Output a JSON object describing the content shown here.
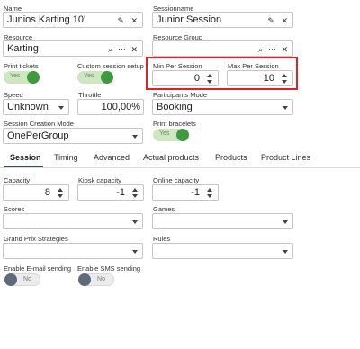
{
  "name": {
    "label": "Name",
    "value": "Junios Karting 10'"
  },
  "sessionname": {
    "label": "Sessionname",
    "value": "Junior Session"
  },
  "resource": {
    "label": "Resource",
    "value": "Karting"
  },
  "resource_group": {
    "label": "Resource Group",
    "value": ""
  },
  "print_tickets": {
    "label": "Print tickets",
    "state": "Yes"
  },
  "custom_session_setup": {
    "label": "Custom session setup",
    "state": "Yes"
  },
  "min_per_session": {
    "label": "Min Per Session",
    "value": "0"
  },
  "max_per_session": {
    "label": "Max Per Session",
    "value": "10"
  },
  "speed": {
    "label": "Speed",
    "value": "Unknown"
  },
  "throttle": {
    "label": "Throttle",
    "value": "100,00%"
  },
  "participants_mode": {
    "label": "Participants Mode",
    "value": "Booking"
  },
  "session_creation_mode": {
    "label": "Session Creation Mode",
    "value": "OnePerGroup"
  },
  "print_bracelets": {
    "label": "Print bracelets",
    "state": "Yes"
  },
  "tabs": [
    {
      "label": "Session"
    },
    {
      "label": "Timing"
    },
    {
      "label": "Advanced"
    },
    {
      "label": "Actual products"
    },
    {
      "label": "Products"
    },
    {
      "label": "Product Lines"
    }
  ],
  "capacity": {
    "label": "Capacity",
    "value": "8"
  },
  "kiosk_capacity": {
    "label": "Kiosk capacity",
    "value": "-1"
  },
  "online_capacity": {
    "label": "Online capacity",
    "value": "-1"
  },
  "scores": {
    "label": "Scores",
    "value": ""
  },
  "games": {
    "label": "Games",
    "value": ""
  },
  "grand_prix": {
    "label": "Grand Prix Strategies",
    "value": ""
  },
  "rules": {
    "label": "Rules",
    "value": ""
  },
  "email_sending": {
    "label": "Enable E-mail sending",
    "state": "No"
  },
  "sms_sending": {
    "label": "Enable SMS sending",
    "state": "No"
  },
  "icons": {
    "edit": "✎",
    "clear": "✕",
    "search": "⌕",
    "more": "···"
  },
  "colors": {
    "highlight": "#e0202a",
    "toggle_on": "#3f9a3f",
    "toggle_off_knob": "#5e6b7a"
  }
}
